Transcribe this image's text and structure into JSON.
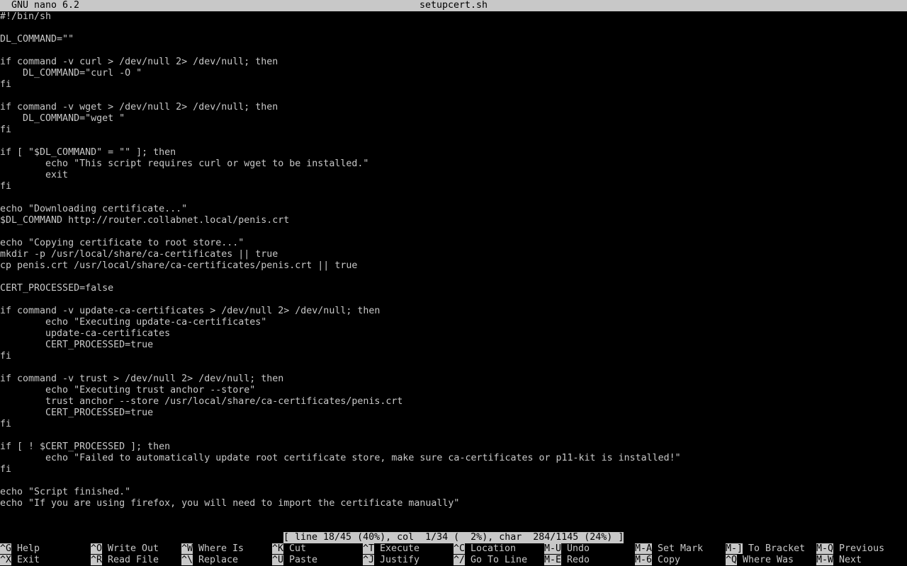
{
  "titlebar": {
    "app": "GNU nano 6.2",
    "filename": "setupcert.sh"
  },
  "editor": {
    "lines": [
      "#!/bin/sh",
      "",
      "DL_COMMAND=\"\"",
      "",
      "if command -v curl > /dev/null 2> /dev/null; then",
      "    DL_COMMAND=\"curl -O \"",
      "fi",
      "",
      "if command -v wget > /dev/null 2> /dev/null; then",
      "    DL_COMMAND=\"wget \"",
      "fi",
      "",
      "if [ \"$DL_COMMAND\" = \"\" ]; then",
      "        echo \"This script requires curl or wget to be installed.\"",
      "        exit",
      "fi",
      "",
      "echo \"Downloading certificate...\"",
      "$DL_COMMAND http://router.collabnet.local/penis.crt",
      "",
      "echo \"Copying certificate to root store...\"",
      "mkdir -p /usr/local/share/ca-certificates || true",
      "cp penis.crt /usr/local/share/ca-certificates/penis.crt || true",
      "",
      "CERT_PROCESSED=false",
      "",
      "if command -v update-ca-certificates > /dev/null 2> /dev/null; then",
      "        echo \"Executing update-ca-certificates\"",
      "        update-ca-certificates",
      "        CERT_PROCESSED=true",
      "fi",
      "",
      "if command -v trust > /dev/null 2> /dev/null; then",
      "        echo \"Executing trust anchor --store\"",
      "        trust anchor --store /usr/local/share/ca-certificates/penis.crt",
      "        CERT_PROCESSED=true",
      "fi",
      "",
      "if [ ! $CERT_PROCESSED ]; then",
      "        echo \"Failed to automatically update root certificate store, make sure ca-certificates or p11-kit is installed!\"",
      "fi",
      "",
      "echo \"Script finished.\"",
      "echo \"If you are using firefox, you will need to import the certificate manually\""
    ]
  },
  "statusbar": {
    "text": "[ line 18/45 (40%), col  1/34 (  2%), char  284/1145 (24%) ]"
  },
  "shortcuts": {
    "row1": [
      {
        "key": "^G",
        "label": "Help"
      },
      {
        "key": "^O",
        "label": "Write Out"
      },
      {
        "key": "^W",
        "label": "Where Is"
      },
      {
        "key": "^K",
        "label": "Cut"
      },
      {
        "key": "^T",
        "label": "Execute"
      },
      {
        "key": "^C",
        "label": "Location"
      },
      {
        "key": "M-U",
        "label": "Undo"
      },
      {
        "key": "M-A",
        "label": "Set Mark"
      },
      {
        "key": "M-]",
        "label": "To Bracket"
      },
      {
        "key": "M-Q",
        "label": "Previous"
      }
    ],
    "row2": [
      {
        "key": "^X",
        "label": "Exit"
      },
      {
        "key": "^R",
        "label": "Read File"
      },
      {
        "key": "^\\",
        "label": "Replace"
      },
      {
        "key": "^U",
        "label": "Paste"
      },
      {
        "key": "^J",
        "label": "Justify"
      },
      {
        "key": "^/",
        "label": "Go To Line"
      },
      {
        "key": "M-E",
        "label": "Redo"
      },
      {
        "key": "M-6",
        "label": "Copy"
      },
      {
        "key": "^Q",
        "label": "Where Was"
      },
      {
        "key": "M-W",
        "label": "Next"
      }
    ]
  }
}
